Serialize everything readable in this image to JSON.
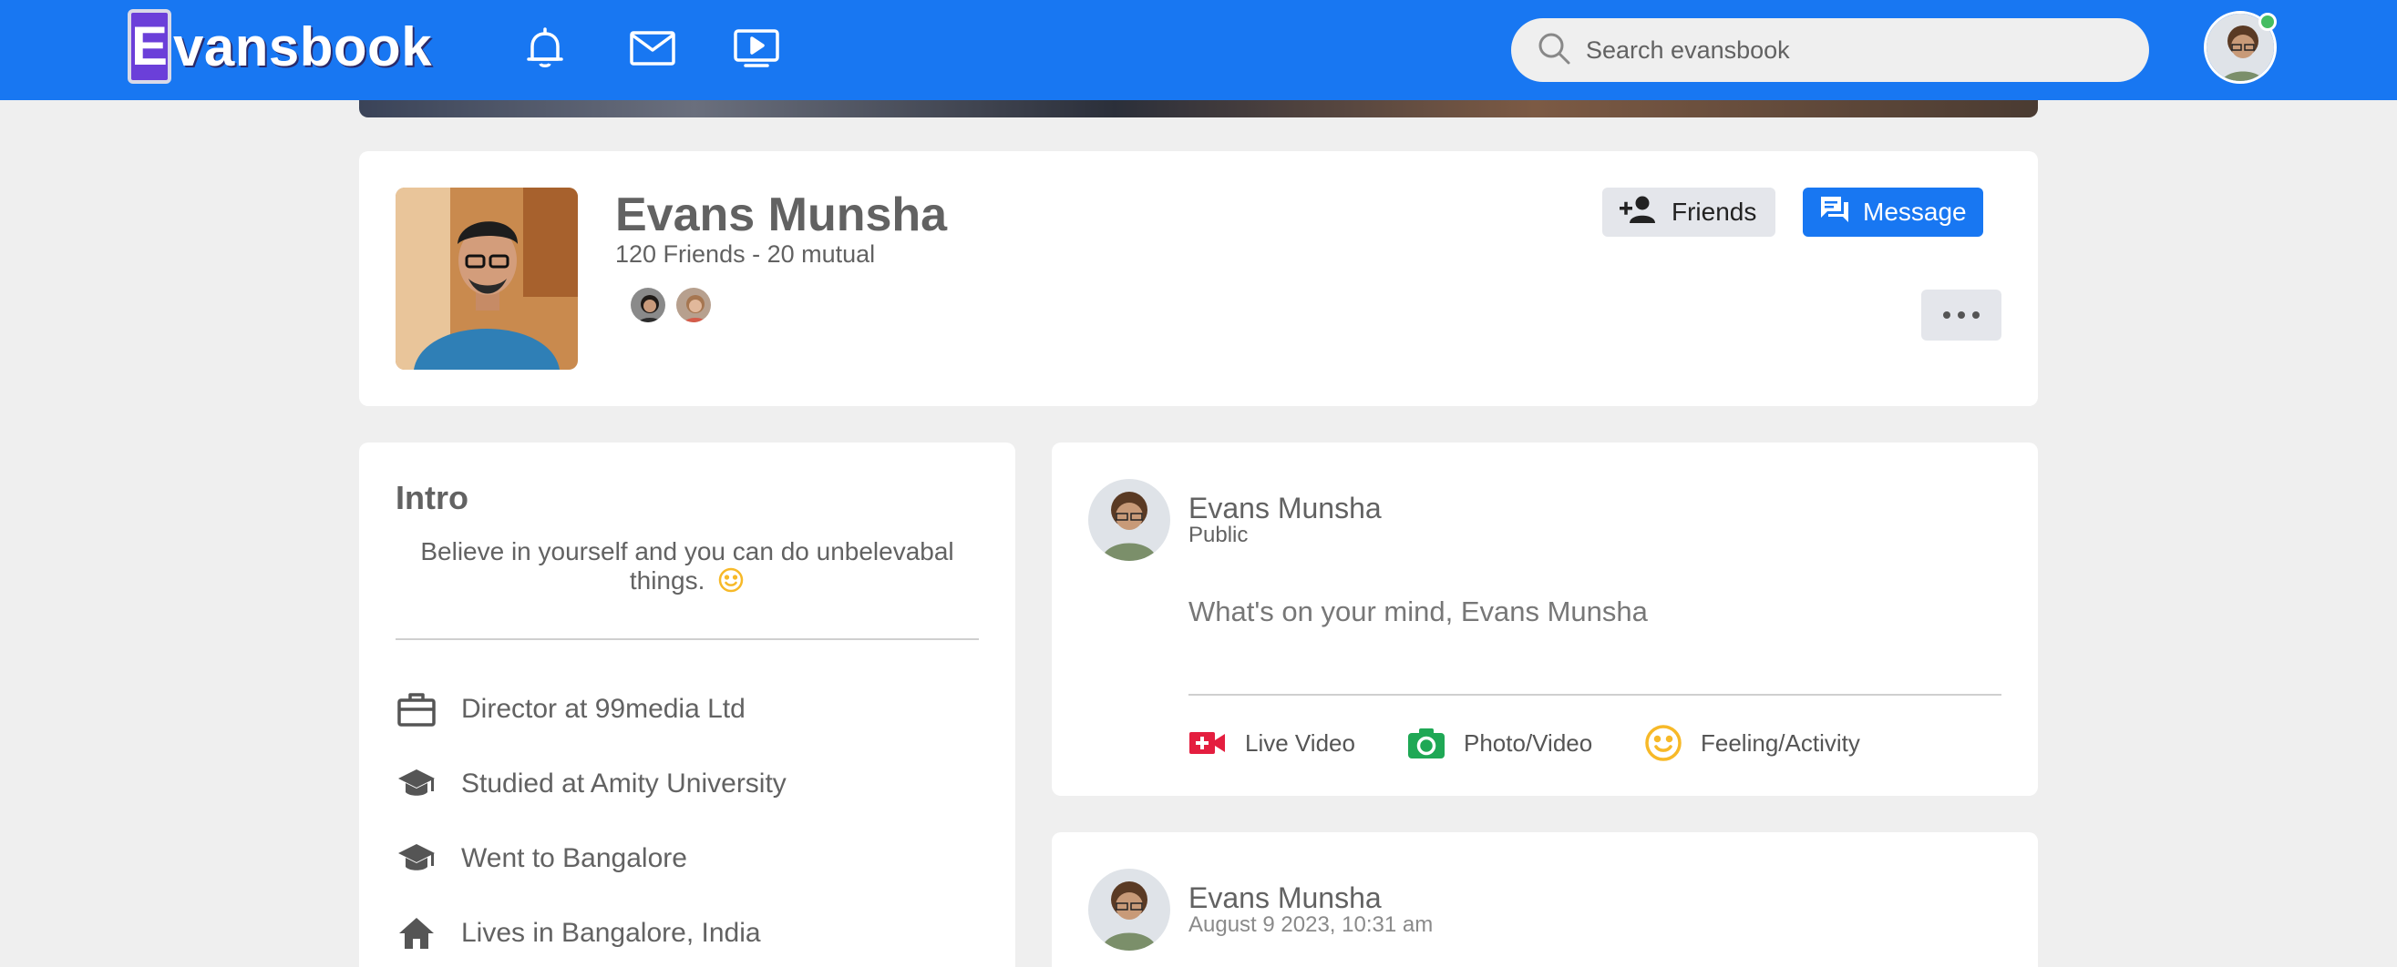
{
  "header": {
    "logo_letter": "E",
    "logo_text": "vansbook",
    "search_placeholder": "Search evansbook",
    "icons": [
      "bell-icon",
      "mail-icon",
      "video-icon",
      "search-icon"
    ],
    "brand_color": "#1877f2",
    "online_color": "#45bd62"
  },
  "profile": {
    "name": "Evans Munsha",
    "friends_line": "120 Friends - 20 mutual",
    "friends_button": "Friends",
    "message_button": "Message"
  },
  "intro": {
    "title": "Intro",
    "bio": "Believe in yourself and you can do unbelevabal things.",
    "items": [
      {
        "icon": "briefcase-icon",
        "text": "Director at 99media Ltd"
      },
      {
        "icon": "graduation-cap-icon",
        "text": "Studied at Amity University"
      },
      {
        "icon": "graduation-cap-icon",
        "text": "Went to Bangalore"
      },
      {
        "icon": "home-icon",
        "text": "Lives in Bangalore, India"
      }
    ]
  },
  "composer": {
    "author": "Evans Munsha",
    "visibility": "Public",
    "prompt": "What's on your mind, Evans Munsha",
    "actions": [
      {
        "label": "Live Video",
        "icon": "live-video-icon",
        "color": "#e41e3f"
      },
      {
        "label": "Photo/Video",
        "icon": "camera-icon",
        "color": "#1fa855"
      },
      {
        "label": "Feeling/Activity",
        "icon": "smile-icon",
        "color": "#f7b928"
      }
    ]
  },
  "post": {
    "author": "Evans Munsha",
    "date": "August 9 2023, 10:31 am"
  }
}
